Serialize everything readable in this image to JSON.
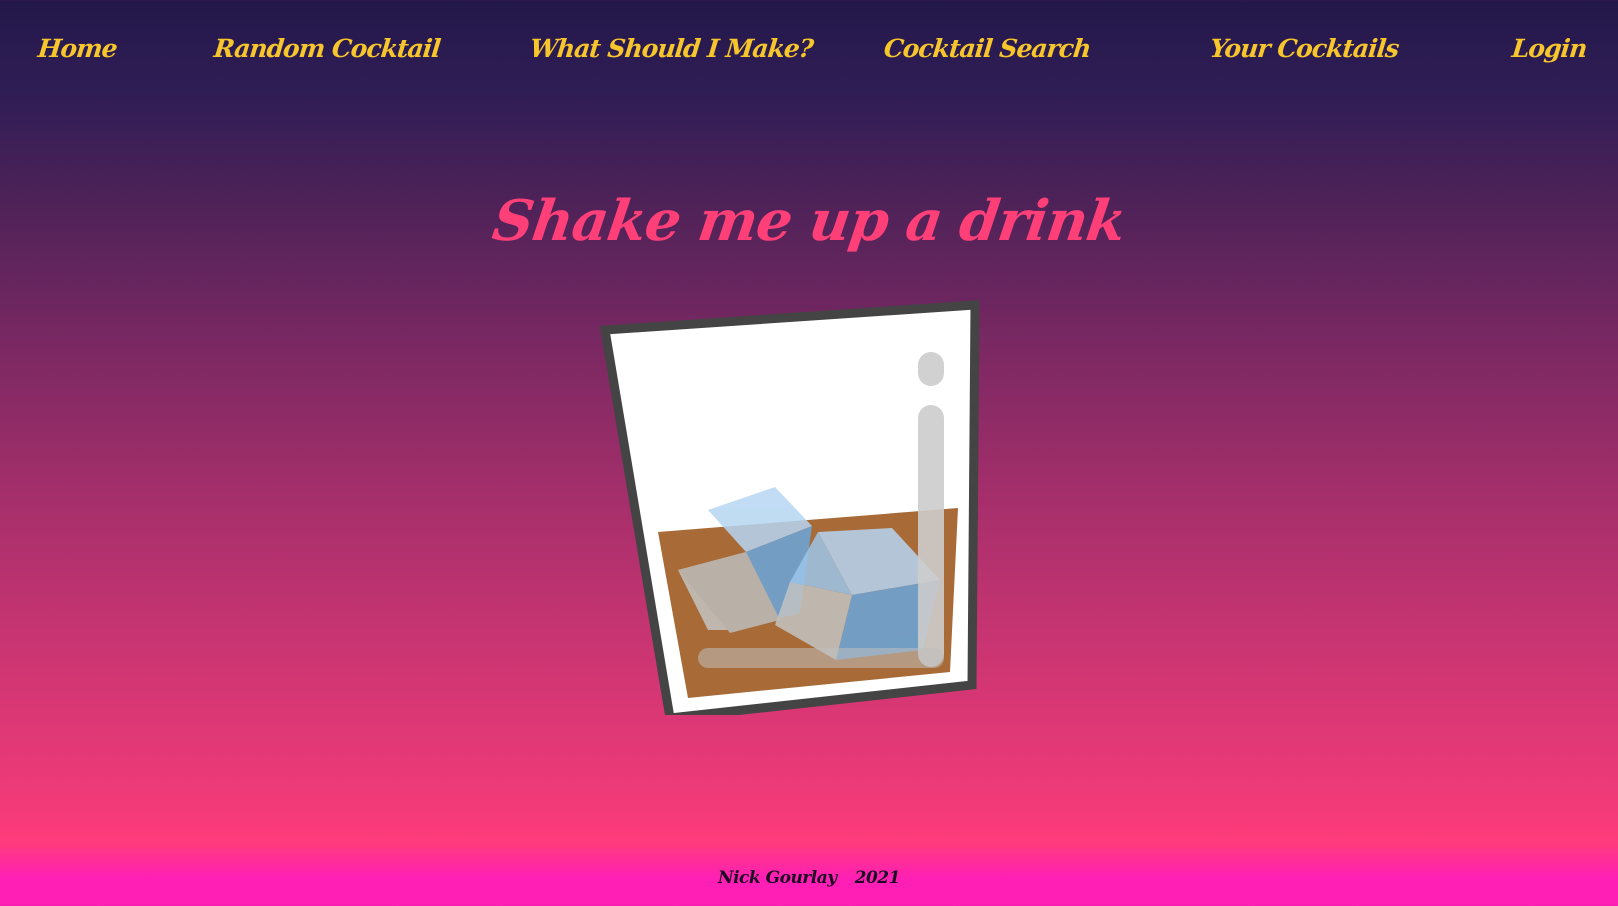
{
  "nav": {
    "items": [
      {
        "label": "Home"
      },
      {
        "label": "Random Cocktail"
      },
      {
        "label": "What Should I Make?"
      },
      {
        "label": "Cocktail Search"
      },
      {
        "label": "Your Cocktails"
      },
      {
        "label": "Login"
      }
    ]
  },
  "hero": {
    "title": "Shake me up a drink",
    "image_icon": "whiskey-glass-icon"
  },
  "footer": {
    "author": "Nick Gourlay",
    "year": "2021"
  },
  "colors": {
    "nav_text": "#f7c52c",
    "title_text": "#ff3f78",
    "gradient_top": "#23184a",
    "gradient_bottom": "#ff1fb5"
  }
}
